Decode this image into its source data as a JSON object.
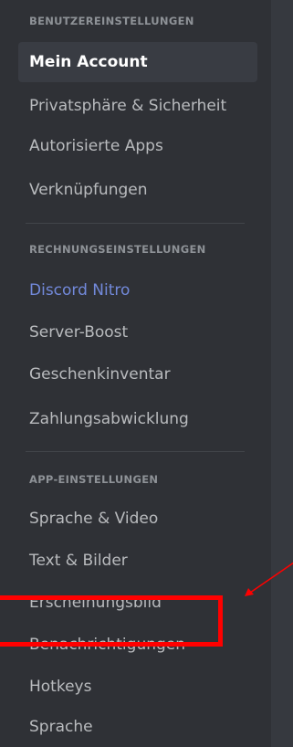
{
  "sections": [
    {
      "header": "BENUTZEREINSTELLUNGEN",
      "items": [
        {
          "label": "Mein Account"
        },
        {
          "label": "Privatsphäre & Sicherheit"
        },
        {
          "label": "Autorisierte Apps"
        },
        {
          "label": "Verknüpfungen"
        }
      ]
    },
    {
      "header": "RECHNUNGSEINSTELLUNGEN",
      "items": [
        {
          "label": "Discord Nitro"
        },
        {
          "label": "Server-Boost"
        },
        {
          "label": "Geschenkinventar"
        },
        {
          "label": "Zahlungsabwicklung"
        }
      ]
    },
    {
      "header": "APP-EINSTELLUNGEN",
      "items": [
        {
          "label": "Sprache & Video"
        },
        {
          "label": "Text & Bilder"
        },
        {
          "label": "Erscheinungsbild"
        },
        {
          "label": "Benachrichtigungen"
        },
        {
          "label": "Hotkeys"
        },
        {
          "label": "Sprache"
        }
      ]
    }
  ],
  "active_item": "Mein Account",
  "colors": {
    "sidebar_bg": "#2f3136",
    "main_bg": "#36393f",
    "active_bg": "#393c43",
    "text": "#b9bbbe",
    "header_text": "#8e9297",
    "nitro_text": "#7289da",
    "annotation": "#ff0000"
  }
}
